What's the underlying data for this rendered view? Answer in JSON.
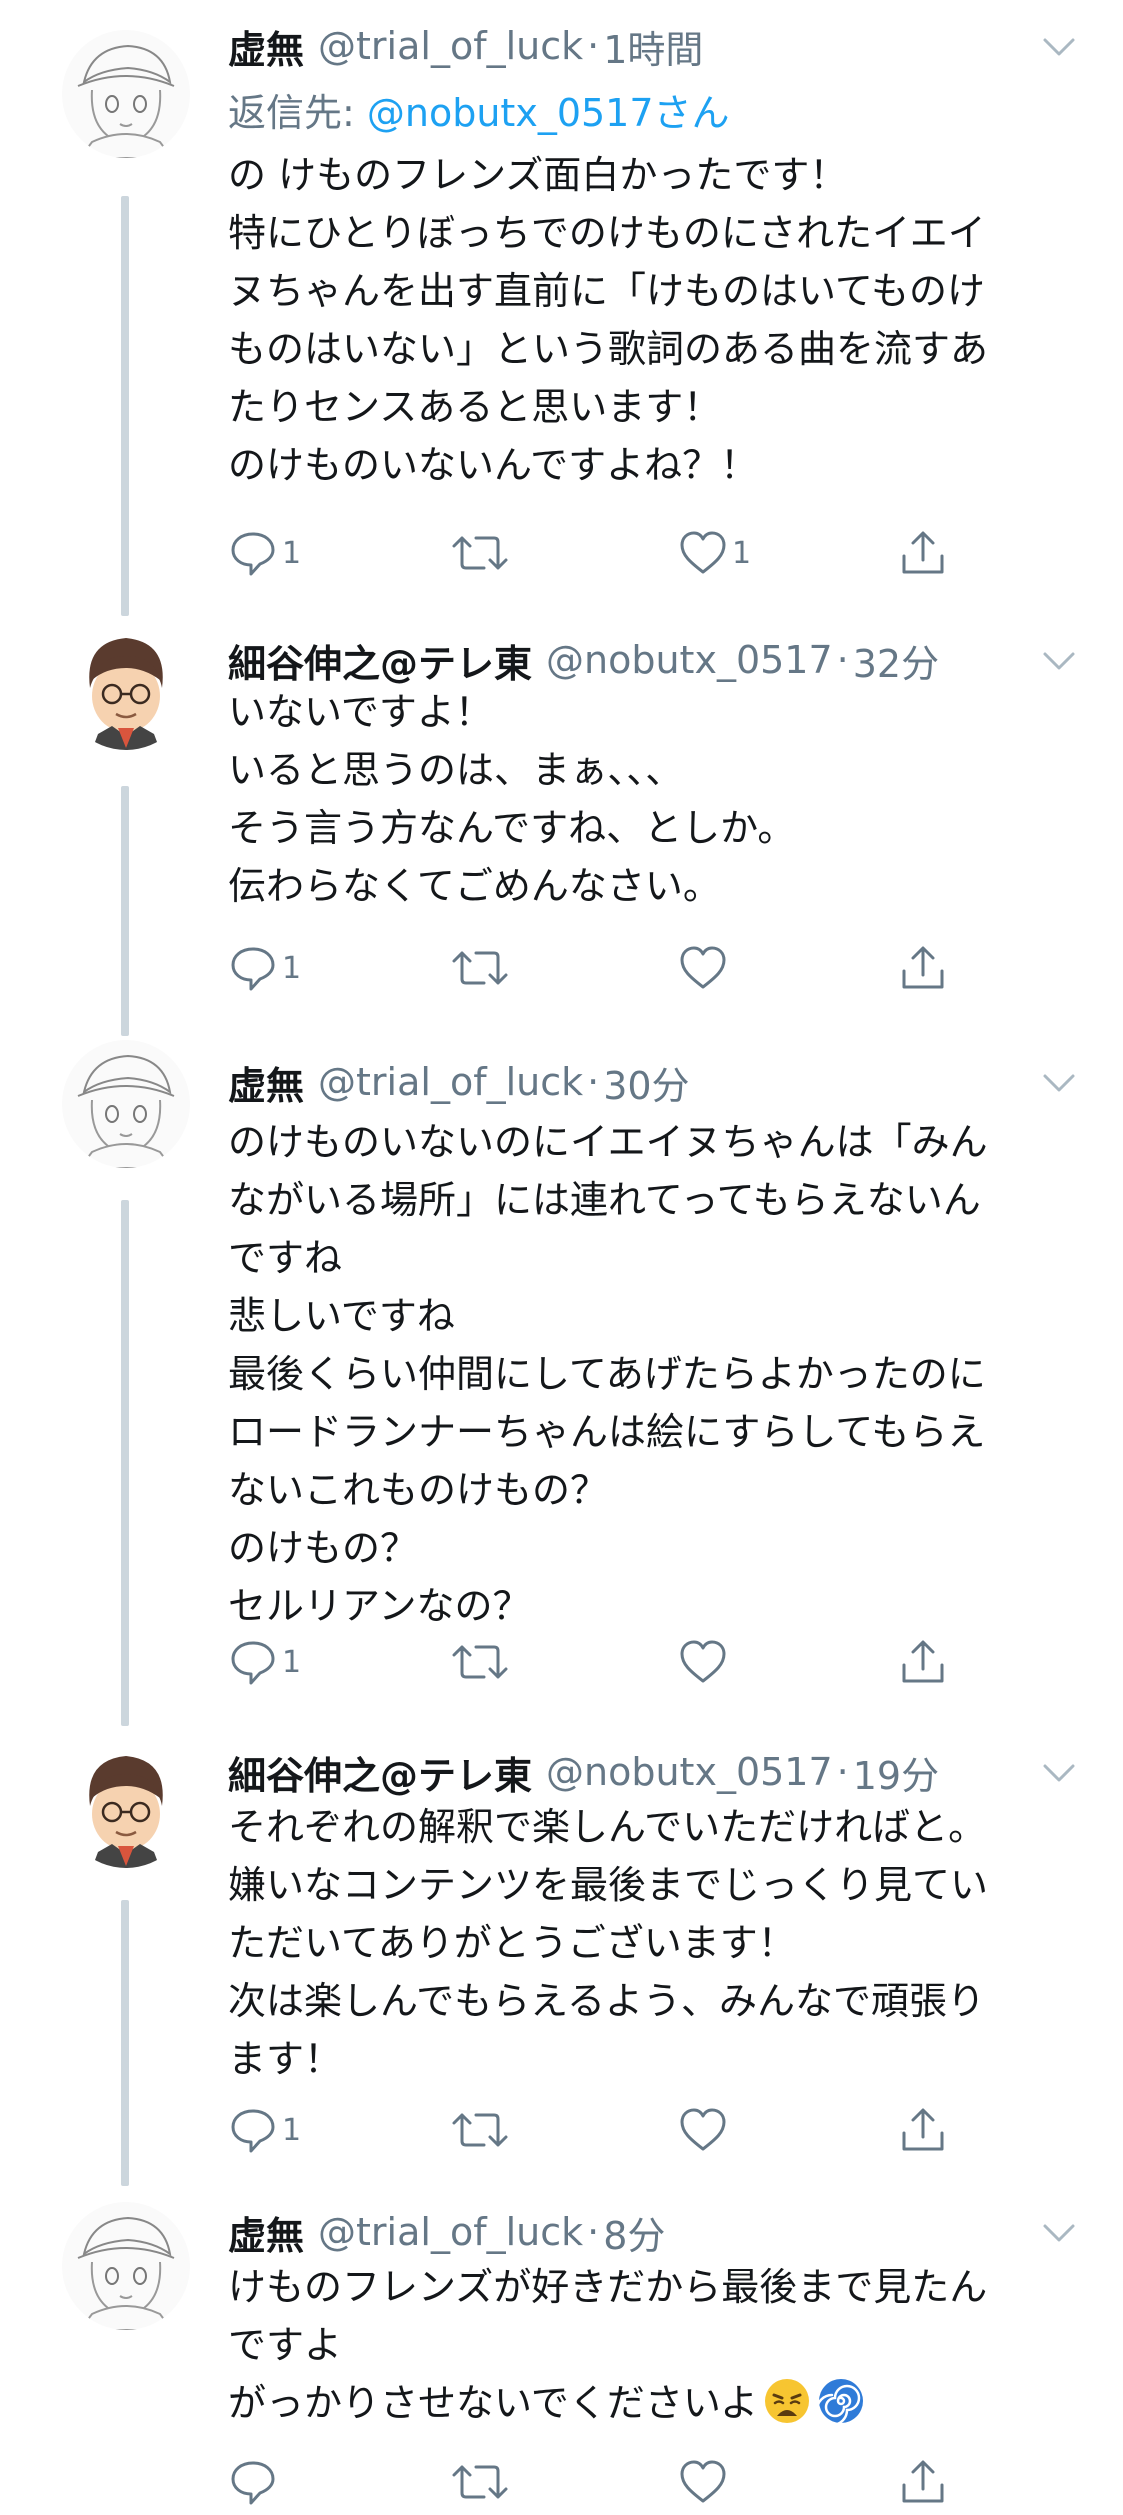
{
  "tweets": [
    {
      "author": "虚無",
      "handle": "@trial_of_luck",
      "dot": "·",
      "time": "1時間",
      "reply_label": "返信先: ",
      "reply_to": "@nobutx_0517さん",
      "lines": [
        "の けものフレンズ面白かったです！",
        "特にひとりぼっちでのけものにされたイエイ",
        "ヌちゃんを出す直前に「けものはいてものけ",
        "ものはいない」という歌詞のある曲を流すあ",
        "たりセンスあると思います！",
        "のけものいないんですよね？！"
      ],
      "reply_count": "1",
      "like_count": "1"
    },
    {
      "author": "細谷伸之@テレ東",
      "handle": "@nobutx_0517",
      "dot": "·",
      "time": "32分",
      "lines": [
        "いないですよ！",
        "いると思うのは、まぁ、、、",
        "そう言う方なんですね、としか。",
        "伝わらなくてごめんなさい。"
      ],
      "reply_count": "1",
      "like_count": ""
    },
    {
      "author": "虚無",
      "handle": "@trial_of_luck",
      "dot": "·",
      "time": "30分",
      "lines": [
        "のけものいないのにイエイヌちゃんは「みん",
        "ながいる場所」には連れてってもらえないん",
        "ですね",
        "悲しいですね",
        "最後くらい仲間にしてあげたらよかったのに",
        "ロードランナーちゃんは絵にすらしてもらえ",
        "ないこれものけもの？",
        "のけもの？",
        "セルリアンなの？"
      ],
      "reply_count": "1",
      "like_count": ""
    },
    {
      "author": "細谷伸之@テレ東",
      "handle": "@nobutx_0517",
      "dot": "·",
      "time": "19分",
      "lines": [
        "それぞれの解釈で楽しんでいただければと。",
        "嫌いなコンテンツを最後までじっくり見てい",
        "ただいてありがとうございます！",
        "次は楽しんでもらえるよう、みんなで頑張り",
        "ます！"
      ],
      "reply_count": "1",
      "like_count": ""
    },
    {
      "author": "虚無",
      "handle": "@trial_of_luck",
      "dot": "·",
      "time": "8分",
      "lines": [
        "けものフレンズが好きだから最後まで見たん",
        "ですよ",
        "がっかりさせないでくださいよ"
      ],
      "trailing_emoji": [
        "weary-face",
        "cyclone"
      ],
      "reply_count": "",
      "like_count": ""
    }
  ],
  "icons": {
    "reply": "speech-bubble",
    "retweet": "retweet-arrows",
    "like": "heart",
    "share": "share-upload",
    "menu": "chevron-down"
  },
  "colors": {
    "text": "#14171a",
    "secondary": "#657786",
    "link": "#1da1f2",
    "thread_line": "#ccd6dd"
  }
}
